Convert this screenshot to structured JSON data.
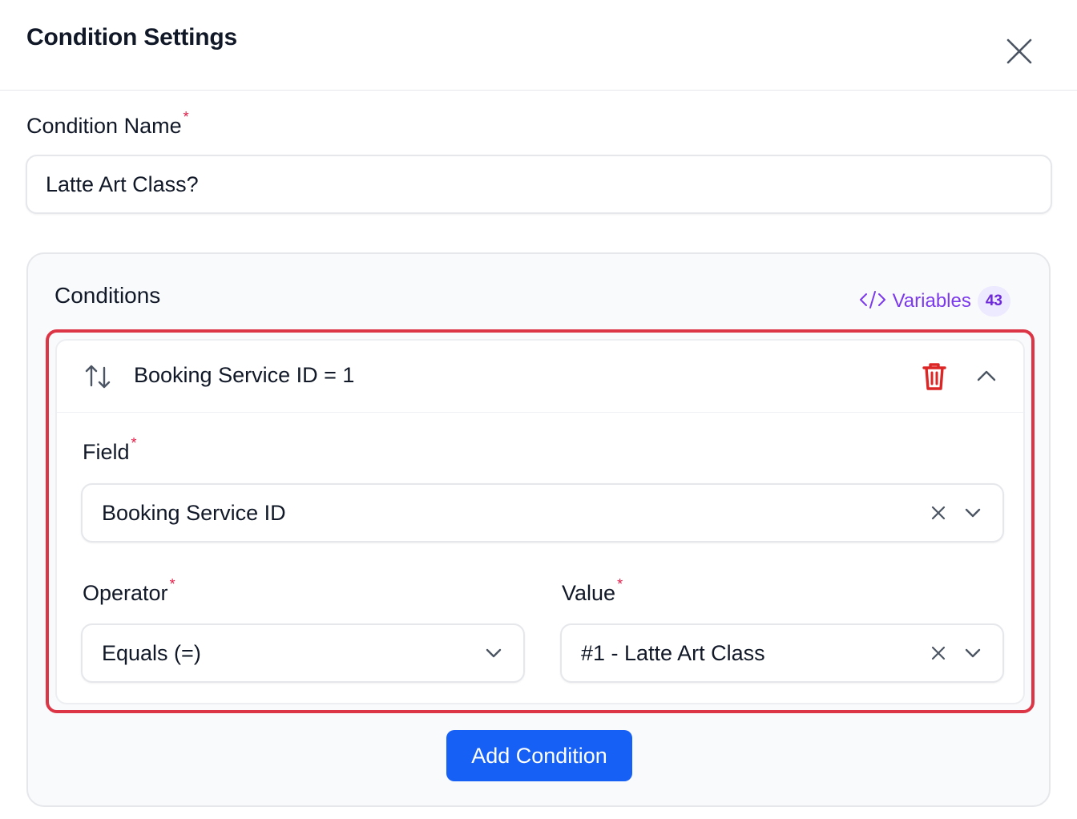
{
  "modal": {
    "title": "Condition Settings"
  },
  "condition_name": {
    "label": "Condition Name",
    "required_mark": "*",
    "value": "Latte Art Class?"
  },
  "conditions": {
    "heading": "Conditions",
    "variables_label": "Variables",
    "variables_count": "43",
    "items": [
      {
        "summary": "Booking Service ID = 1",
        "field": {
          "label": "Field",
          "required_mark": "*",
          "value": "Booking Service ID"
        },
        "operator": {
          "label": "Operator",
          "required_mark": "*",
          "value": "Equals (=)"
        },
        "value": {
          "label": "Value",
          "required_mark": "*",
          "value": "#1 - Latte Art Class"
        }
      }
    ],
    "add_button_label": "Add Condition"
  },
  "colors": {
    "accent_blue": "#1660f5",
    "variables_purple": "#7c3aed",
    "danger_red": "#dc2626",
    "highlight_border": "#dc3545"
  },
  "icons": [
    "close-icon",
    "code-icon",
    "sort-arrows-icon",
    "trash-icon",
    "chevron-up-icon",
    "clear-x-icon",
    "chevron-down-icon"
  ]
}
